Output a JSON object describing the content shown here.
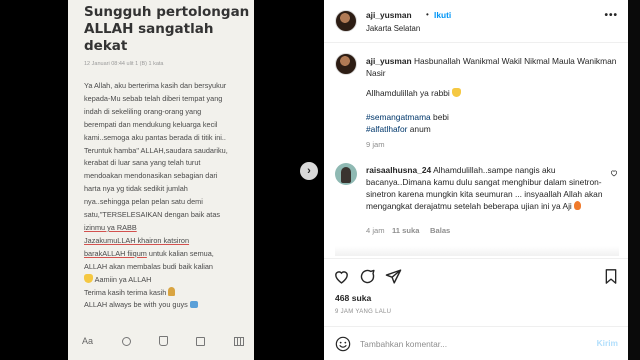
{
  "note": {
    "title_line1": "Sungguh pertolongan",
    "title_line2": "ALLAH sangatlah dekat",
    "date": "12 Januari 08:44 ulit 1 (B) 1 kata",
    "lines": [
      "Ya Allah, aku berterima kasih dan bersyukur",
      "kepada-Mu sebab telah diberi tempat yang",
      "indah di sekeliling orang-orang yang",
      "berempati dan mendukung keluarga kecil",
      "kami..semoga aku pantas berada di titik ini..",
      "Teruntuk hamba\" ALLAH,saudara saudariku,",
      "kerabat di luar sana yang telah turut",
      "mendoakan mendonasikan sebagian dari",
      "harta nya yg tidak sedikit jumlah",
      "nya..sehingga pelan pelan satu demi",
      "satu,\"TERSELESAIKAN dengan baik atas",
      "izinmu ya RABB"
    ],
    "line_jaz_1": "JazakumuLLAH khairon katsiron",
    "line_jaz_2a": "barakALLAH fiiqum",
    "line_jaz_2b": " untuk kalian semua,",
    "line_14": "ALLAH akan membalas budi baik kalian",
    "line_15": "Aamiin ya ALLAH",
    "line_16": "Terima kasih terima kasih",
    "line_17": "ALLAH always be with you guys",
    "toolbar_aa": "Aa"
  },
  "post": {
    "username": "aji_yusman",
    "separator": "•",
    "follow_label": "Ikuti",
    "location": "Jakarta Selatan",
    "more_label": "•••",
    "caption_user": "aji_yusman",
    "caption_text": "Hasbunallah Wanikmal Wakil Nikmal Maula Wanikman Nasir",
    "caption_line2": "Allhamdulillah ya rabbi",
    "hashtag1": "#semangatmama",
    "hashtag1_tail": " bebi",
    "hashtag2": "#alfatlhafor",
    "hashtag2_tail": " anum",
    "caption_time": "9 jam",
    "comment_user": "raisaalhusna_24",
    "comment_text": "Alhamdulillah..sampe nangis aku bacanya..Dimana kamu dulu sangat menghibur dalam sinetron-sinetron karena mungkin kita seumuran ... insyaallah Allah akan mengangkat derajatmu setelah beberapa ujian ini ya Aji",
    "comment_time": "4 jam",
    "comment_likes": "11 suka",
    "comment_reply": "Balas",
    "likes": "468 suka",
    "time_ago": "9 JAM YANG LALU",
    "comment_placeholder": "Tambahkan komentar...",
    "post_label": "Kirim"
  },
  "colors": {
    "link_blue": "#0095f6",
    "hashtag_blue": "#00376b",
    "muted_gray": "#8e8e8e",
    "note_bg": "#f2f1ec"
  },
  "icons": [
    "heart-icon",
    "comment-icon",
    "share-icon",
    "bookmark-icon",
    "smile-icon",
    "chevron-right-icon",
    "chevron-left-icon"
  ]
}
